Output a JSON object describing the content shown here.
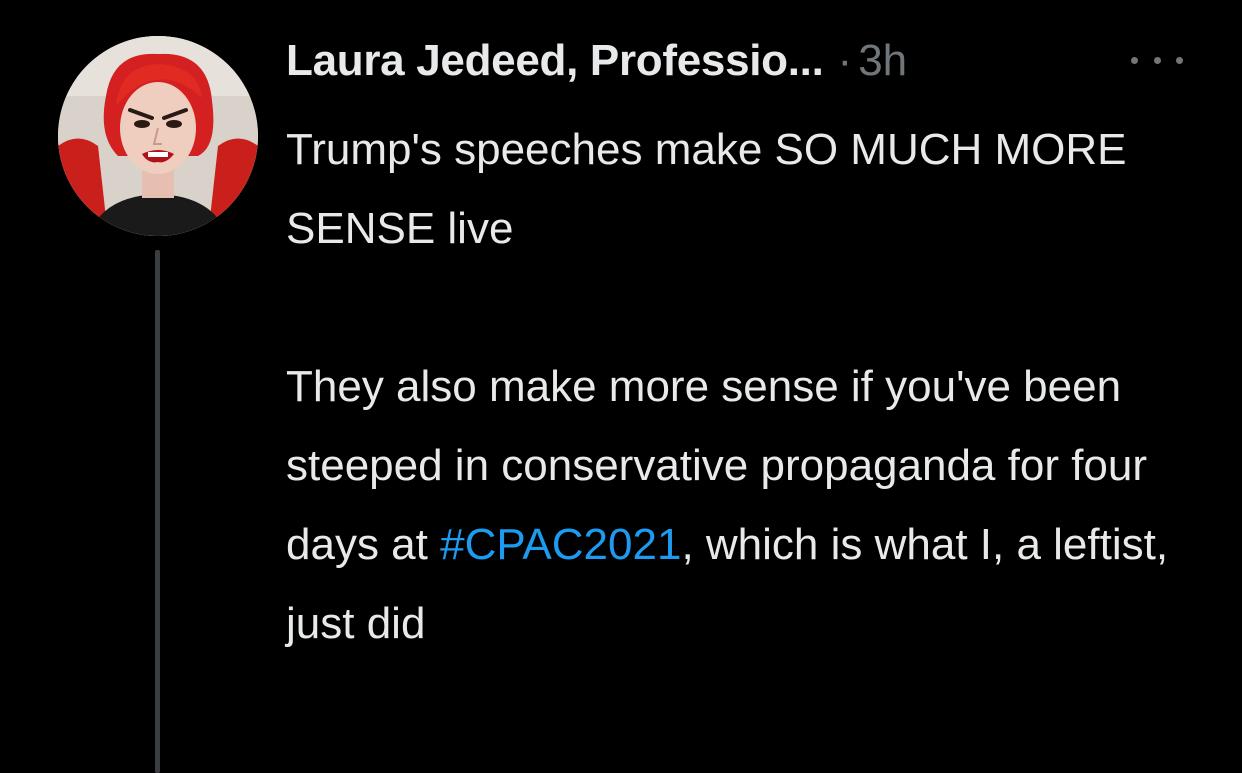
{
  "tweet": {
    "display_name": "Laura Jedeed, Professio...",
    "separator": "·",
    "time": "3h",
    "paragraph1": "Trump's speeches make SO MUCH MORE SENSE live",
    "paragraph2_before": "They also make more sense if you've been steeped in conservative propaganda for four days at ",
    "hashtag": "#CPAC2021",
    "paragraph2_after": ", which is what I, a leftist, just did"
  },
  "icons": {
    "avatar": "profile-photo",
    "more": "ellipsis-icon"
  },
  "colors": {
    "background": "#000000",
    "text": "#e7e9ea",
    "muted": "#71767b",
    "link": "#1d9bf0",
    "thread_line": "#3a3d41"
  }
}
